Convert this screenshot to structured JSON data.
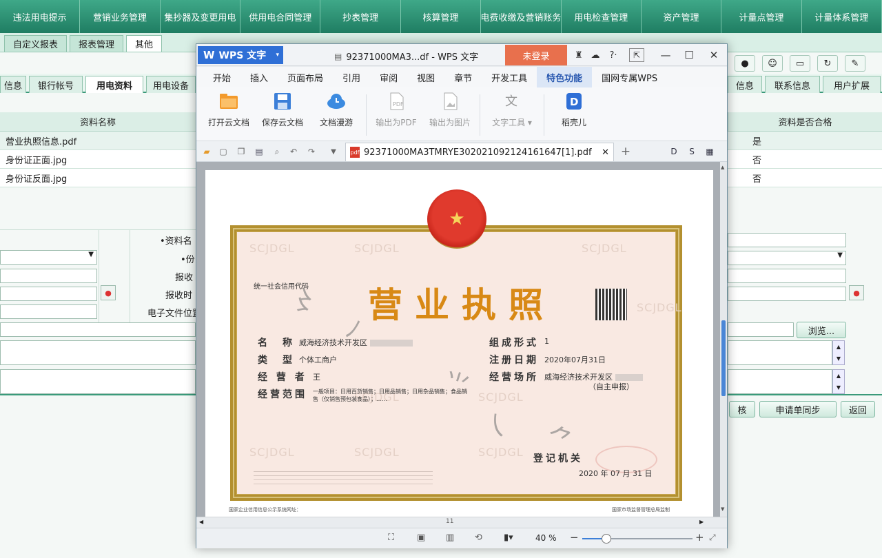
{
  "topnav": [
    "违法用电提示",
    "营销业务管理",
    "集抄器及变更用电",
    "供用电合同管理",
    "抄表管理",
    "核算管理",
    "电费收缴及营销账务",
    "用电检查管理",
    "资产管理",
    "计量点管理",
    "计量体系管理"
  ],
  "subtabs": [
    "自定义报表",
    "报表管理",
    "其他"
  ],
  "tabrow_left": [
    "信息",
    "银行帐号",
    "用电资料",
    "用电设备"
  ],
  "tabrow_right": [
    "信息",
    "联系信息",
    "用户扩展"
  ],
  "table": {
    "col_name": "资料名称",
    "col_ok": "资料是否合格",
    "rows": [
      {
        "name": "营业执照信息.pdf",
        "ok": "是"
      },
      {
        "name": "身份证正面.jpg",
        "ok": "否"
      },
      {
        "name": "身份证反面.jpg",
        "ok": "否"
      }
    ]
  },
  "form": {
    "label_name": "•资料名",
    "label_2": "•份",
    "label_3": "报收",
    "label_4": "报收时",
    "label_file": "电子文件位置",
    "browse": "浏览..."
  },
  "buttons": {
    "sync": "申请单同步",
    "back": "返回",
    "check": "核"
  },
  "wps": {
    "app": "WPS 文字",
    "title": "92371000MA3...df - WPS 文字",
    "login": "未登录",
    "tabs": [
      "开始",
      "插入",
      "页面布局",
      "引用",
      "审阅",
      "视图",
      "章节",
      "开发工具",
      "特色功能",
      "国网专属WPS"
    ],
    "active_tab": "特色功能",
    "ribbon": [
      {
        "icon": "folder-cloud-icon",
        "label": "打开云文档",
        "enabled": true
      },
      {
        "icon": "save-cloud-icon",
        "label": "保存云文档",
        "enabled": true
      },
      {
        "icon": "cloud-icon",
        "label": "文档漫游",
        "enabled": true
      },
      {
        "icon": "pdf-export-icon",
        "label": "输出为PDF",
        "enabled": false
      },
      {
        "icon": "image-export-icon",
        "label": "输出为图片",
        "enabled": false
      },
      {
        "icon": "text-tool-icon",
        "label": "文字工具",
        "enabled": false
      },
      {
        "icon": "translate-icon",
        "label": "稻壳儿",
        "enabled": true
      }
    ],
    "doc_tab": "92371000MA3TMRYE302021092124161647[1].pdf",
    "page_indicator": "11",
    "zoom": "40 %",
    "zoom_fraction": 0.22
  },
  "cert": {
    "title": "营业执照",
    "credit_code_label": "统一社会信用代码",
    "name_label": "名　称",
    "name_value": "威海经济技术开发区",
    "type_label": "类　型",
    "type_value": "个体工商户",
    "operator_label": "经 营 者",
    "operator_value": "王",
    "scope_label": "经营范围",
    "scope_value": "一般项目：日用百货销售；日用品销售；日用杂品销售；食品销售（仅销售预包装食品）；……",
    "form_label": "组成形式",
    "form_value": "1",
    "date_label": "注册日期",
    "date_value": "2020年07月31日",
    "place_label": "经营场所",
    "place_value": "威海经济技术开发区",
    "place_note": "（自主申报）",
    "authority_label": "登记机关",
    "authority_value": "2020 年 07 月 31 日",
    "watermark": "SCJDGL",
    "footer_left": "国家企业信用信息公示系统网址：",
    "footer_right": "国家市场监督管理总局监制"
  }
}
